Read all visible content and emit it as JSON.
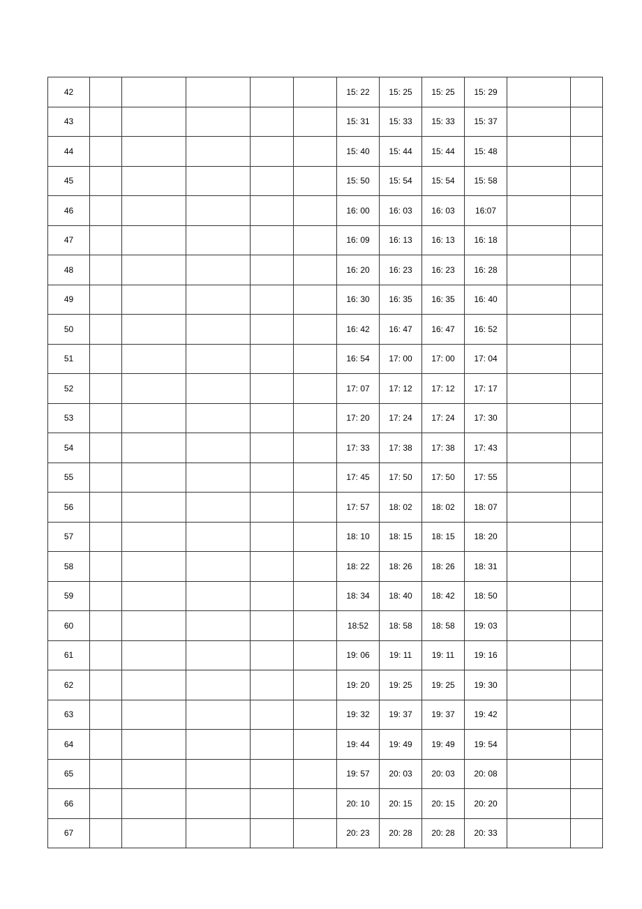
{
  "table": {
    "columns": 12,
    "rows": [
      {
        "n": "42",
        "t": [
          "15: 22",
          "15: 25",
          "15: 25",
          "15: 29"
        ]
      },
      {
        "n": "43",
        "t": [
          "15: 31",
          "15: 33",
          "15: 33",
          "15: 37"
        ]
      },
      {
        "n": "44",
        "t": [
          "15: 40",
          "15: 44",
          "15: 44",
          "15: 48"
        ]
      },
      {
        "n": "45",
        "t": [
          "15: 50",
          "15: 54",
          "15: 54",
          "15: 58"
        ]
      },
      {
        "n": "46",
        "t": [
          "16: 00",
          "16: 03",
          "16: 03",
          "16:07"
        ]
      },
      {
        "n": "47",
        "t": [
          "16: 09",
          "16: 13",
          "16: 13",
          "16: 18"
        ]
      },
      {
        "n": "48",
        "t": [
          "16: 20",
          "16: 23",
          "16: 23",
          "16: 28"
        ]
      },
      {
        "n": "49",
        "t": [
          "16: 30",
          "16: 35",
          "16: 35",
          "16: 40"
        ]
      },
      {
        "n": "50",
        "t": [
          "16: 42",
          "16: 47",
          "16: 47",
          "16: 52"
        ]
      },
      {
        "n": "51",
        "t": [
          "16: 54",
          "17: 00",
          "17: 00",
          "17: 04"
        ]
      },
      {
        "n": "52",
        "t": [
          "17: 07",
          "17: 12",
          "17: 12",
          "17: 17"
        ]
      },
      {
        "n": "53",
        "t": [
          "17: 20",
          "17: 24",
          "17: 24",
          "17: 30"
        ]
      },
      {
        "n": "54",
        "t": [
          "17: 33",
          "17: 38",
          "17: 38",
          "17: 43"
        ]
      },
      {
        "n": "55",
        "t": [
          "17: 45",
          "17: 50",
          "17: 50",
          "17: 55"
        ]
      },
      {
        "n": "56",
        "t": [
          "17: 57",
          "18: 02",
          "18: 02",
          "18: 07"
        ]
      },
      {
        "n": "57",
        "t": [
          "18: 10",
          "18: 15",
          "18: 15",
          "18: 20"
        ]
      },
      {
        "n": "58",
        "t": [
          "18: 22",
          "18: 26",
          "18: 26",
          "18: 31"
        ]
      },
      {
        "n": "59",
        "t": [
          "18: 34",
          "18: 40",
          "18: 42",
          "18: 50"
        ]
      },
      {
        "n": "60",
        "t": [
          "18:52",
          "18: 58",
          "18: 58",
          "19: 03"
        ]
      },
      {
        "n": "61",
        "t": [
          "19: 06",
          "19: 11",
          "19: 11",
          "19: 16"
        ]
      },
      {
        "n": "62",
        "t": [
          "19: 20",
          "19: 25",
          "19: 25",
          "19: 30"
        ]
      },
      {
        "n": "63",
        "t": [
          "19: 32",
          "19: 37",
          "19: 37",
          "19: 42"
        ]
      },
      {
        "n": "64",
        "t": [
          "19: 44",
          "19: 49",
          "19: 49",
          "19: 54"
        ]
      },
      {
        "n": "65",
        "t": [
          "19: 57",
          "20: 03",
          "20: 03",
          "20: 08"
        ]
      },
      {
        "n": "66",
        "t": [
          "20: 10",
          "20: 15",
          "20: 15",
          "20: 20"
        ]
      },
      {
        "n": "67",
        "t": [
          "20: 23",
          "20: 28",
          "20: 28",
          "20: 33"
        ]
      }
    ]
  }
}
